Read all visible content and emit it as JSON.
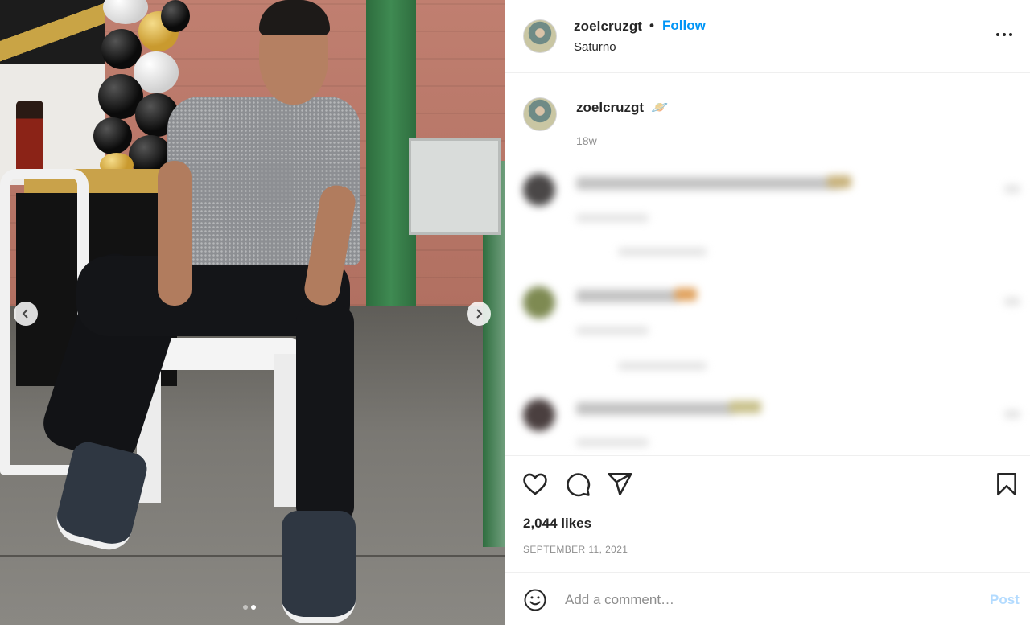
{
  "post": {
    "username": "zoelcruzgt",
    "separator": "•",
    "follow_label": "Follow",
    "location": "Saturno",
    "caption_username": "zoelcruzgt",
    "caption_emoji": "🪐",
    "caption_time": "18w",
    "likes": "2,044 likes",
    "date": "SEPTEMBER 11, 2021"
  },
  "carousel": {
    "slide_count": 2,
    "active_slide": 2
  },
  "comment_box": {
    "placeholder": "Add a comment…",
    "post_label": "Post"
  },
  "icons": {
    "like": "heart-icon",
    "comment": "comment-icon",
    "share": "send-icon",
    "save": "bookmark-icon",
    "emoji": "emoji-icon",
    "more": "more-options-icon",
    "prev": "chevron-left-icon",
    "next": "chevron-right-icon"
  },
  "colors": {
    "accent": "#0095f6",
    "post_disabled": "#b3dbff",
    "muted": "#8e8e8e"
  }
}
